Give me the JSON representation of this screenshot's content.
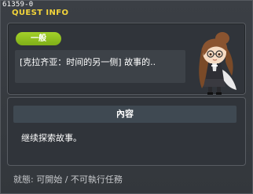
{
  "window": {
    "quest_id": "61359-0",
    "title": "QUEST INFO"
  },
  "quest": {
    "category": "一般",
    "name": "[克拉齐亚：时间的另一侧] 故事的..",
    "character_icon": "npc-portrait-icon"
  },
  "content": {
    "header": "內容",
    "text": "继续探索故事。"
  },
  "status": {
    "text": "就態: 可開始 / 不可執行任務"
  },
  "colors": {
    "title": "#f3d43a",
    "badge": "#8fbf1f",
    "panel_bg": "#30343a",
    "window_bg": "#383c42"
  }
}
